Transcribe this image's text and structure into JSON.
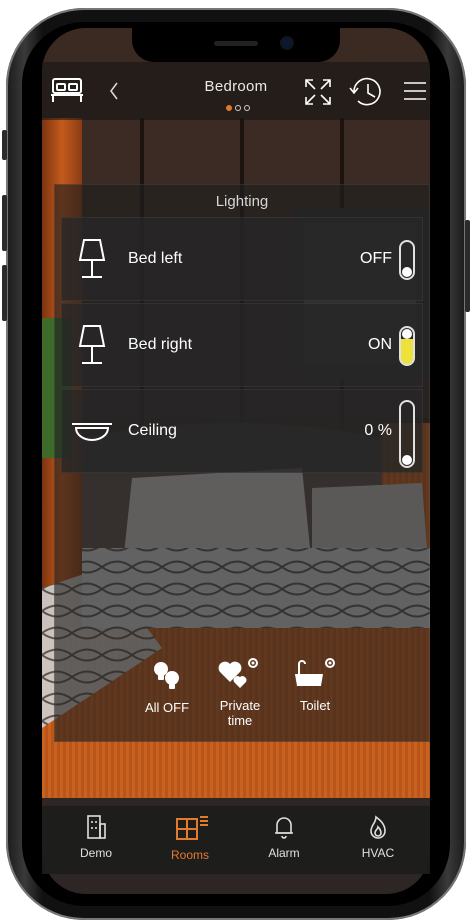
{
  "header": {
    "room_title": "Bedroom",
    "pages": 3,
    "active_page": 0,
    "icons": [
      "bed-icon",
      "back-chevron-icon",
      "fullscreen-icon",
      "history-clock-icon",
      "menu-icon"
    ]
  },
  "lighting": {
    "title": "Lighting",
    "rows": [
      {
        "label": "Bed left",
        "state": "OFF",
        "icon": "table-lamp-icon",
        "on": false
      },
      {
        "label": "Bed right",
        "state": "ON",
        "icon": "table-lamp-icon",
        "on": true
      },
      {
        "label": "Ceiling",
        "state": "0 %",
        "icon": "ceiling-light-icon",
        "level": 0
      }
    ]
  },
  "scenes": [
    {
      "label": "All OFF",
      "icon": "bulbs-icon"
    },
    {
      "label": "Private time",
      "line1": "Private",
      "line2": "time",
      "icon": "hearts-settings-icon"
    },
    {
      "label": "Toilet",
      "icon": "bathtub-settings-icon"
    }
  ],
  "tabs": [
    {
      "label": "Demo",
      "icon": "building-icon",
      "active": false
    },
    {
      "label": "Rooms",
      "icon": "floorplan-icon",
      "active": true
    },
    {
      "label": "Alarm",
      "icon": "bell-icon",
      "active": false
    },
    {
      "label": "HVAC",
      "icon": "flame-icon",
      "active": false
    }
  ],
  "colors": {
    "accent": "#e37a2c",
    "on_toggle": "#ece23a",
    "text": "#ffffff"
  }
}
